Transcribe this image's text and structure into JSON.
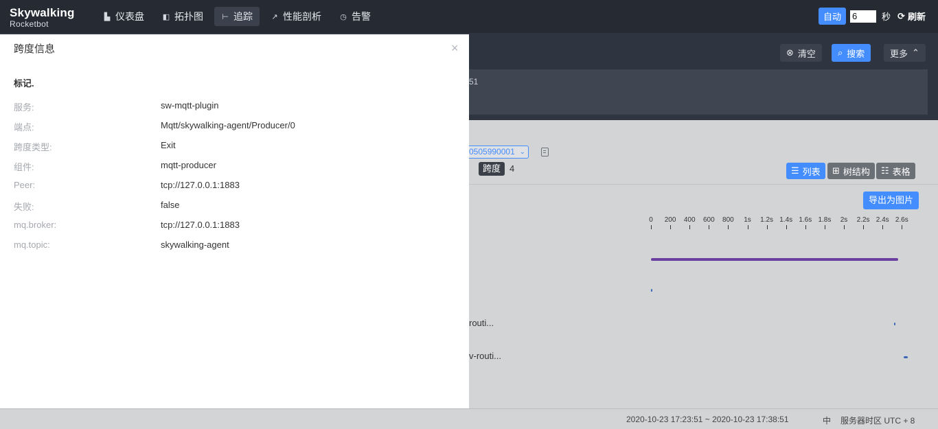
{
  "brand": {
    "name": "Skywalking",
    "sub": "Rocketbot"
  },
  "nav": [
    {
      "icon": "dashboard-icon",
      "label": "仪表盘"
    },
    {
      "icon": "topology-icon",
      "label": "拓扑图"
    },
    {
      "icon": "trace-icon",
      "label": "追踪",
      "active": true
    },
    {
      "icon": "profile-icon",
      "label": "性能剖析"
    },
    {
      "icon": "alarm-icon",
      "label": "告警"
    }
  ],
  "toolbar": {
    "auto_label": "自动",
    "interval_value": "6",
    "seconds_label": "秒",
    "refresh_label": "刷新"
  },
  "search": {
    "clear_label": "清空",
    "search_label": "搜索",
    "more_label": "更多",
    "panel_text": "51"
  },
  "trace": {
    "id_partial": "0505990001",
    "span_label": "跨度",
    "span_count": "4",
    "views": {
      "list": "列表",
      "tree": "树结构",
      "table": "表格"
    },
    "export_label": "导出为图片",
    "axis_ticks": [
      "0",
      "200",
      "400",
      "600",
      "800",
      "1s",
      "1.2s",
      "1.4s",
      "1.6s",
      "1.8s",
      "2s",
      "2.2s",
      "2.4s",
      "2.6s"
    ],
    "rows": [
      {
        "label": "",
        "start": 0.0,
        "end": 1.0
      },
      {
        "label": "",
        "start": 0.0,
        "end": 0.0
      },
      {
        "label": "routi...",
        "start": 0.994,
        "end": 0.994
      },
      {
        "label": "v-routi...",
        "start": 1.0,
        "end": 1.0
      }
    ]
  },
  "footer": {
    "time_range": "2020-10-23 17:23:51 ~ 2020-10-23 17:38:51",
    "lang": "中",
    "timezone": "服务器时区 UTC + 8"
  },
  "drawer": {
    "title": "跨度信息",
    "close_label": "×",
    "tags_title": "标记.",
    "fields": [
      {
        "key": "服务:",
        "value": "sw-mqtt-plugin"
      },
      {
        "key": "端点:",
        "value": "Mqtt/skywalking-agent/Producer/0"
      },
      {
        "key": "跨度类型:",
        "value": "Exit"
      },
      {
        "key": "组件:",
        "value": "mqtt-producer"
      },
      {
        "key": "Peer:",
        "value": "tcp://127.0.0.1:1883"
      },
      {
        "key": "失败:",
        "value": "false"
      },
      {
        "key": "mq.broker:",
        "value": "tcp://127.0.0.1:1883"
      },
      {
        "key": "mq.topic:",
        "value": "skywalking-agent"
      }
    ]
  },
  "colors": {
    "accent": "#448dfe",
    "topbar": "#252a33",
    "search_bg": "#2f3540",
    "bar_main": "#6a3fa0",
    "bar_small": "#3f67b8"
  }
}
